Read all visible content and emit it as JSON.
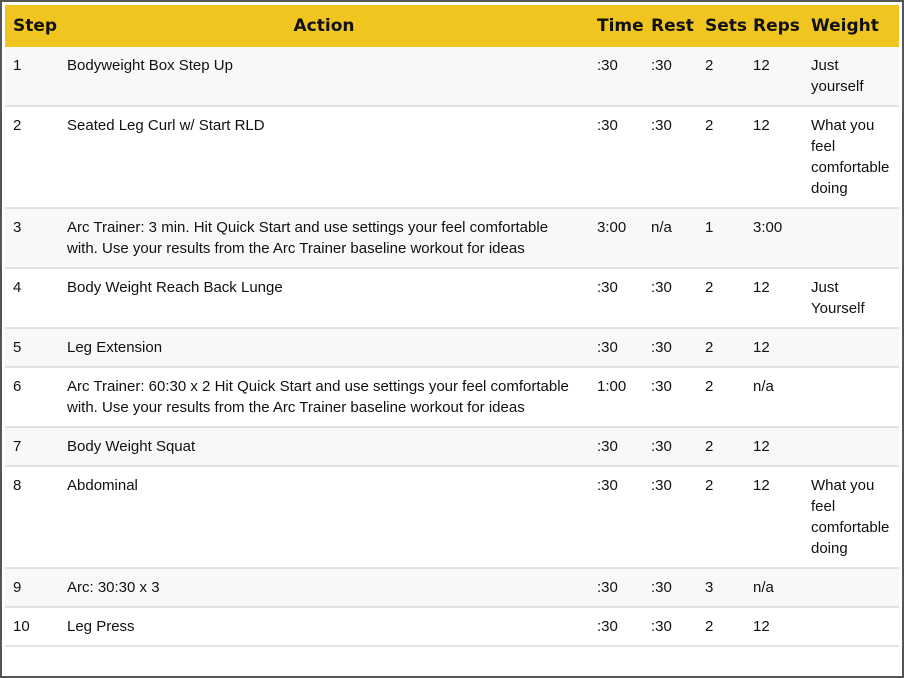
{
  "headers": {
    "step": "Step",
    "action": "Action",
    "time": "Time",
    "rest": "Rest",
    "sets": "Sets",
    "reps": "Reps",
    "weight": "Weight"
  },
  "rows": [
    {
      "step": "1",
      "action": "Bodyweight Box Step Up",
      "time": ":30",
      "rest": ":30",
      "sets": "2",
      "reps": "12",
      "weight": "Just yourself"
    },
    {
      "step": "2",
      "action": "Seated Leg Curl w/ Start RLD",
      "time": ":30",
      "rest": ":30",
      "sets": "2",
      "reps": "12",
      "weight": "What you feel comfortable doing"
    },
    {
      "step": "3",
      "action": "Arc Trainer: 3 min. Hit Quick Start and use settings your feel comfortable with. Use your results from the Arc Trainer baseline workout for ideas",
      "time": "3:00",
      "rest": "n/a",
      "sets": "1",
      "reps": "3:00",
      "weight": ""
    },
    {
      "step": "4",
      "action": "Body Weight Reach Back Lunge",
      "time": ":30",
      "rest": ":30",
      "sets": "2",
      "reps": "12",
      "weight": "Just Yourself"
    },
    {
      "step": "5",
      "action": "Leg Extension",
      "time": ":30",
      "rest": ":30",
      "sets": "2",
      "reps": "12",
      "weight": ""
    },
    {
      "step": "6",
      "action": "Arc Trainer: 60:30 x 2 Hit Quick Start and use settings your feel comfortable with. Use your results from the Arc Trainer baseline workout for ideas",
      "time": "1:00",
      "rest": ":30",
      "sets": "2",
      "reps": "n/a",
      "weight": ""
    },
    {
      "step": "7",
      "action": "Body Weight Squat",
      "time": ":30",
      "rest": ":30",
      "sets": "2",
      "reps": "12",
      "weight": ""
    },
    {
      "step": "8",
      "action": "Abdominal",
      "time": ":30",
      "rest": ":30",
      "sets": "2",
      "reps": "12",
      "weight": "What you feel comfortable doing"
    },
    {
      "step": "9",
      "action": "Arc: 30:30 x 3",
      "time": ":30",
      "rest": ":30",
      "sets": "3",
      "reps": "n/a",
      "weight": ""
    },
    {
      "step": "10",
      "action": "Leg Press",
      "time": ":30",
      "rest": ":30",
      "sets": "2",
      "reps": "12",
      "weight": ""
    }
  ]
}
